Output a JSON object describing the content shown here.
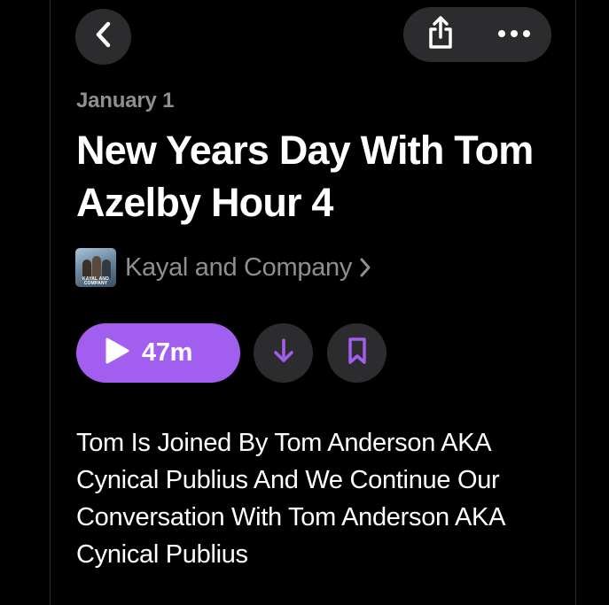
{
  "nav": {
    "back_icon": "chevron-left-icon",
    "share_icon": "share-icon",
    "more_icon": "ellipsis-icon"
  },
  "episode": {
    "date": "January 1",
    "title": "New Years Day With Tom Azelby Hour 4",
    "description": "Tom Is Joined By Tom Anderson AKA Cynical Publius And We Continue Our Conversation With Tom Anderson AKA Cynical Publius"
  },
  "show": {
    "name": "Kayal and Company",
    "artwork_text": "KAYAL AND COMPANY"
  },
  "actions": {
    "play_duration": "47m",
    "download_icon": "download-arrow-icon",
    "bookmark_icon": "bookmark-icon"
  },
  "colors": {
    "accent": "#a25fef",
    "background": "#000000",
    "button_bg": "#2c2c2e",
    "secondary_text": "#8e8e93"
  }
}
